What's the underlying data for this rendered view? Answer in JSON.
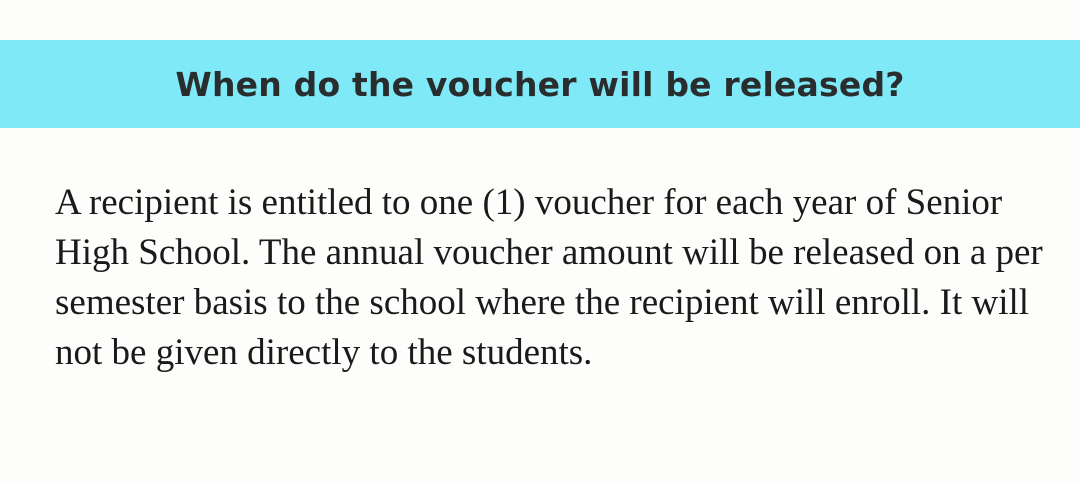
{
  "faq": {
    "question": "When do the voucher will be released?",
    "answer": "A recipient is entitled to one (1) voucher for each year of Senior High School. The annual voucher amount will be released on a per semester basis to the school where the recipient will enroll. It will not be given directly to the students."
  },
  "colors": {
    "header_band": "#7fe9f7",
    "heading_text": "#2a2d2e",
    "body_text": "#1a1a1a",
    "background": "#fdfdfb"
  }
}
